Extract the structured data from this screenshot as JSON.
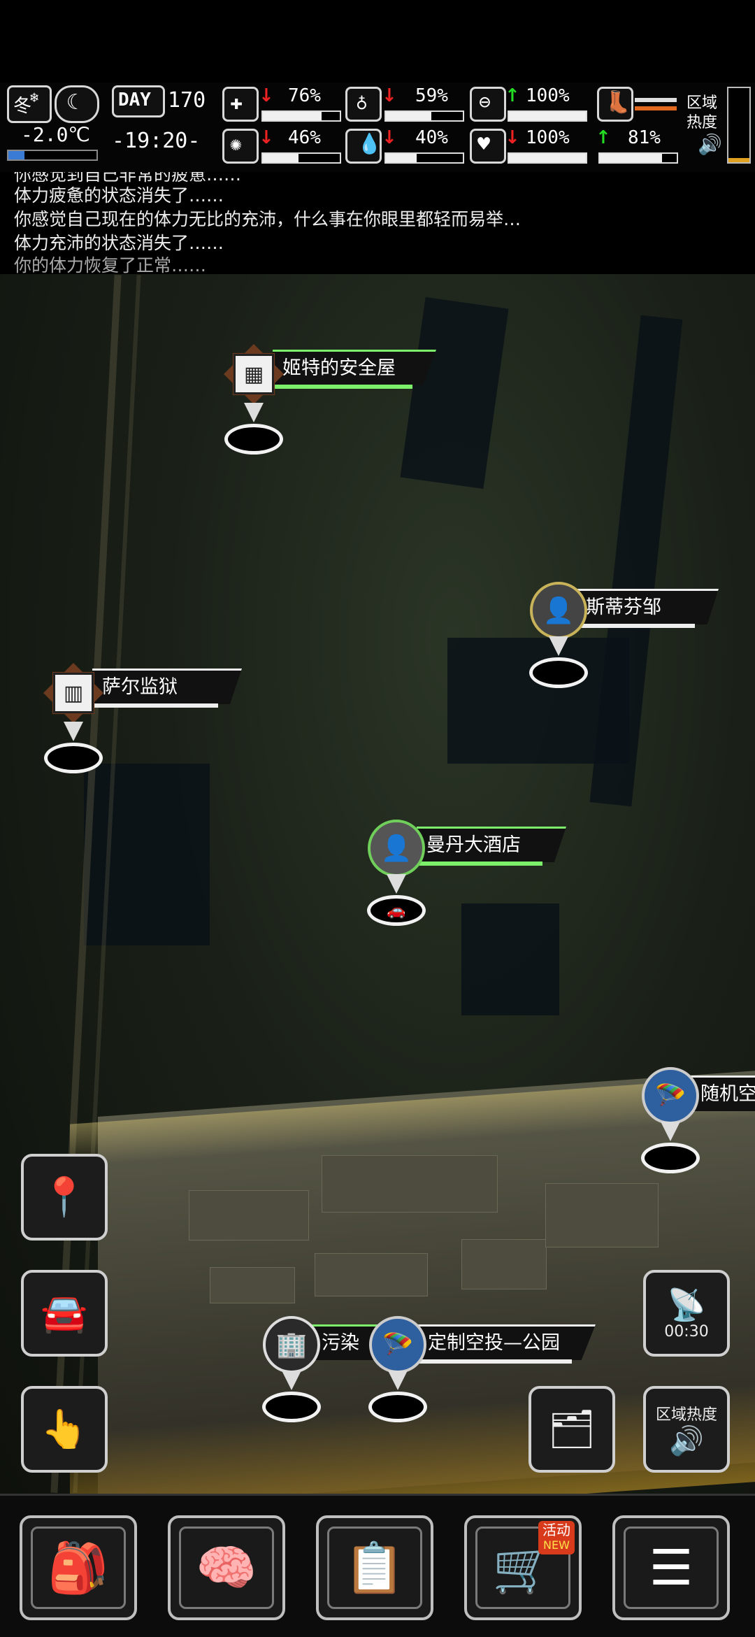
{
  "hud": {
    "season_icon": "snowflake-winter-icon",
    "season_label": "冬",
    "weather_icon": "moon-icon",
    "temperature": "-2.0℃",
    "day_label": "DAY",
    "day_value": "170",
    "time": "-19:20-",
    "stats": [
      {
        "icon": "medkit-icon",
        "trend": "down",
        "value": "76%",
        "fill": 0.76
      },
      {
        "icon": "stomach-icon",
        "trend": "down",
        "value": "59%",
        "fill": 0.59
      },
      {
        "icon": "pill-icon",
        "trend": "up",
        "value": "100%",
        "fill": 1.0
      },
      {
        "icon": "brain-icon",
        "trend": "down",
        "value": "46%",
        "fill": 0.46
      },
      {
        "icon": "water-drop-icon",
        "trend": "down",
        "value": "40%",
        "fill": 0.4
      },
      {
        "icon": "heart-icon",
        "trend": "down",
        "value": "100%",
        "fill": 1.0
      }
    ],
    "stamina": {
      "icon": "boot-icon",
      "trend": "up",
      "value": "81%",
      "fill": 0.81
    },
    "zone_heat_label": "区域热度",
    "sound_icon": "speaker-icon"
  },
  "log": {
    "lines": [
      "你感觉到自己非常的疲惫……",
      "体力疲惫的状态消失了……",
      "你感觉自己现在的体力无比的充沛，什么事在你眼里都轻而易举…",
      "体力充沛的状态消失了……",
      "你的体力恢复了正常……"
    ]
  },
  "map": {
    "markers": {
      "safehouse": {
        "label": "姬特的安全屋",
        "icon": "safehouse-icon"
      },
      "stephen": {
        "label": "斯蒂芬邹",
        "icon": "npc-portrait-icon"
      },
      "prison": {
        "label": "萨尔监狱",
        "icon": "prison-icon"
      },
      "hotel": {
        "label": "曼丹大酒店",
        "icon": "npc-portrait-icon"
      },
      "random": {
        "label": "随机空",
        "icon": "parachute-icon"
      },
      "pollution": {
        "label": "污染",
        "icon": "building-icon"
      },
      "airdrop": {
        "label": "定制空投—公园",
        "icon": "parachute-icon"
      }
    },
    "radar_timer": "00:30",
    "zone_heat_button": "区域热度"
  },
  "side_buttons": [
    "locate-player-icon",
    "car-icon",
    "tap-arrow-icon"
  ],
  "bottom_nav": {
    "backpack": "backpack-icon",
    "skills": "head-brain-icon",
    "tasks": "notebook-icon",
    "shop": "cart-icon",
    "shop_badge_top": "活动",
    "shop_badge_bottom": "NEW",
    "menu": "menu-list-icon"
  },
  "colors": {
    "accent_green": "#7cf06a",
    "marker_brown": "#6b3a1f",
    "airdrop_blue": "#2e5f9e"
  }
}
